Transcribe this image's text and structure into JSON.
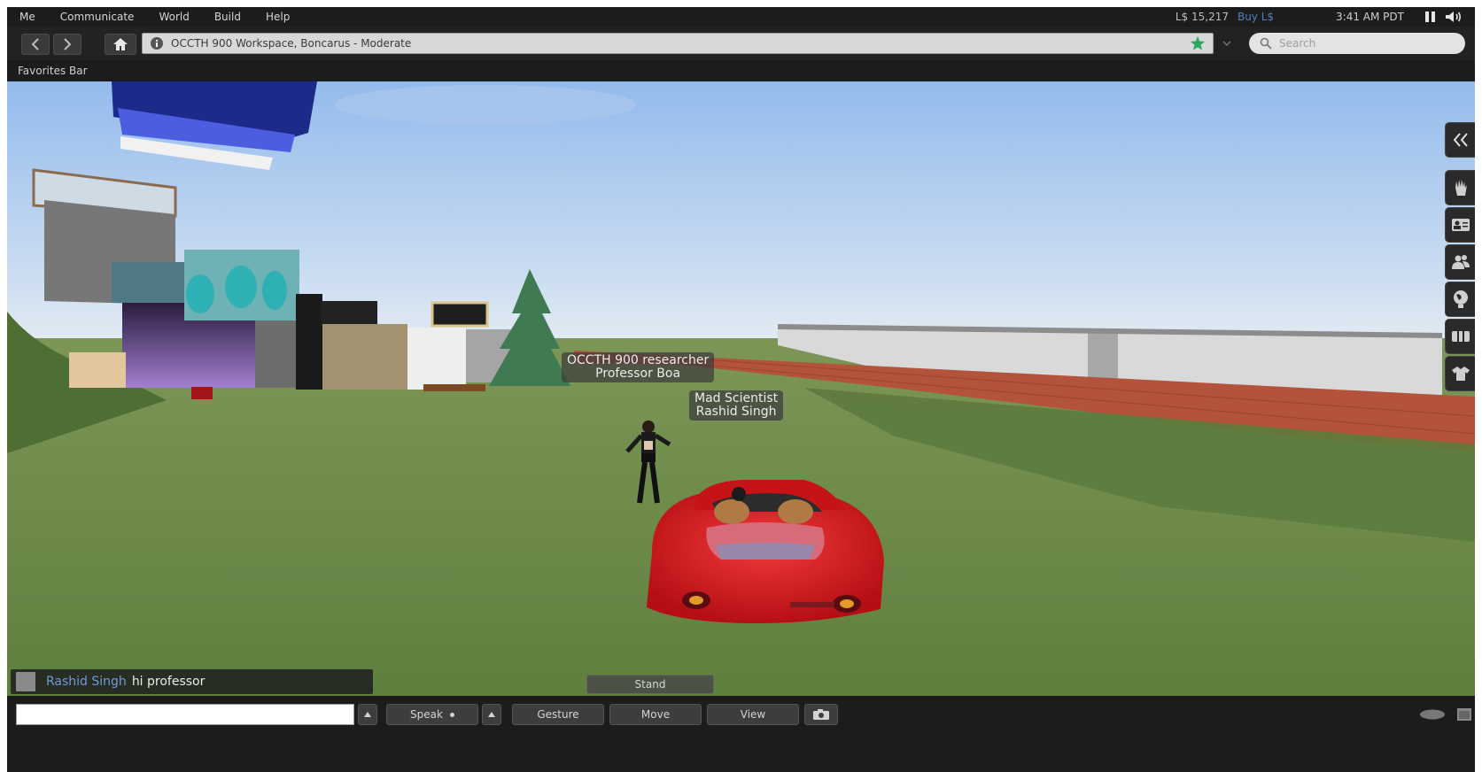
{
  "menubar": {
    "items": [
      "Me",
      "Communicate",
      "World",
      "Build",
      "Help"
    ],
    "balance": "L$ 15,217",
    "buy_label": "Buy L$",
    "time": "3:41 AM PDT",
    "icons": [
      "pause-icon",
      "volume-icon"
    ]
  },
  "navbar": {
    "location": "OCCTH 900 Workspace, Boncarus - Moderate",
    "search_placeholder": "Search",
    "icons": [
      "back-arrow-icon",
      "forward-arrow-icon",
      "home-icon",
      "info-icon",
      "star-icon",
      "chevron-down-icon",
      "search-icon"
    ]
  },
  "favorites_bar": {
    "label": "Favorites Bar"
  },
  "scene": {
    "nametags": [
      {
        "line1": "OCCTH 900 researcher",
        "line2": "Professor Boa"
      },
      {
        "line1": "Mad Scientist",
        "line2": "Rashid Singh"
      }
    ],
    "stand_label": "Stand"
  },
  "sidebar": {
    "icons": [
      "collapse-double-chevron-icon",
      "gestures-hand-icon",
      "profile-card-icon",
      "people-icon",
      "places-globe-icon",
      "landmarks-icon",
      "appearance-shirt-icon"
    ]
  },
  "chat_toast": {
    "sender": "Rashid Singh",
    "message": "hi professor"
  },
  "bottombar": {
    "chat_value": "",
    "speak_label": "Speak",
    "gesture_label": "Gesture",
    "move_label": "Move",
    "view_label": "View",
    "icons": [
      "chat-history-up-icon",
      "speak-dropdown-icon",
      "snapshot-camera-icon",
      "voice-bubble-icon",
      "window-icon"
    ]
  },
  "colors": {
    "sky_top": "#9fc3ee",
    "sky_horizon": "#dfeaf4",
    "grass": "#6f8f4d",
    "car_red": "#d8141a",
    "brick": "#b5523a",
    "link_blue": "#6e9bd8"
  }
}
